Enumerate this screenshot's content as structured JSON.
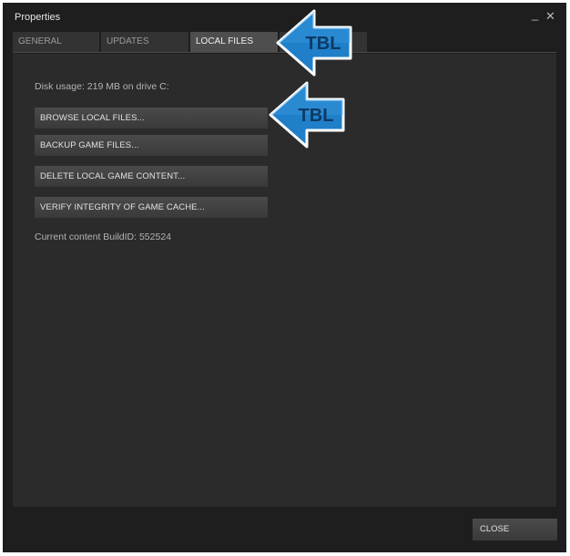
{
  "window": {
    "title": "Properties",
    "minimize_glyph": "_",
    "close_glyph": "✕"
  },
  "tabs": [
    {
      "label": "GENERAL",
      "active": false
    },
    {
      "label": "UPDATES",
      "active": false
    },
    {
      "label": "LOCAL FILES",
      "active": true
    },
    {
      "label": "",
      "active": false
    }
  ],
  "local_files": {
    "disk_usage": "Disk usage: 219 MB on drive C:",
    "buttons": [
      "BROWSE LOCAL FILES...",
      "BACKUP GAME FILES...",
      "DELETE LOCAL GAME CONTENT...",
      "VERIFY INTEGRITY OF GAME CACHE..."
    ],
    "build_id": "Current content BuildID: 552524"
  },
  "footer": {
    "close_label": "CLOSE"
  },
  "annotations": {
    "arrow_text": "TBL",
    "arrow_color": "#1f7fc8"
  }
}
